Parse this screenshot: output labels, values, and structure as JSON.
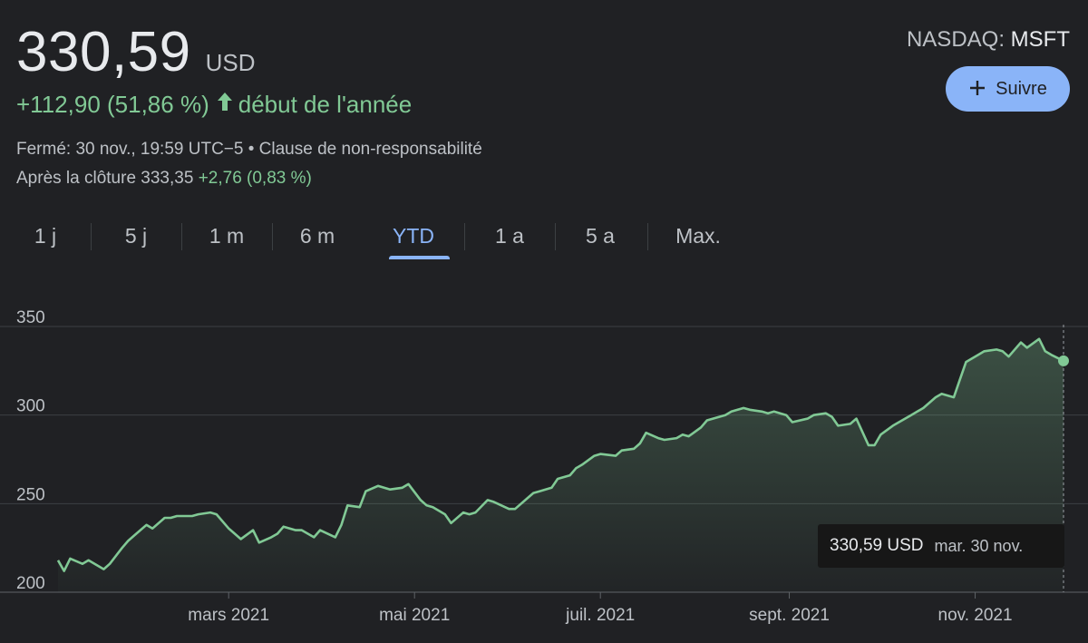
{
  "quote": {
    "price": "330,59",
    "currency": "USD",
    "change": "+112,90 (51,86 %)",
    "change_arrow": "arrow-up-icon",
    "change_period": "début de l'année",
    "closed_text": "Fermé: 30 nov., 19:59 UTC−5 • Clause de non-responsabilité",
    "after_hours_label": "Après la clôture 333,35",
    "after_hours_change": "+2,76 (0,83 %)",
    "exchange": "NASDAQ: ",
    "symbol": "MSFT"
  },
  "follow_button": {
    "label": "Suivre",
    "icon": "plus-icon"
  },
  "tabs": [
    {
      "label": "1 j",
      "active": false
    },
    {
      "label": "5 j",
      "active": false
    },
    {
      "label": "1 m",
      "active": false
    },
    {
      "label": "6 m",
      "active": false
    },
    {
      "label": "YTD",
      "active": true
    },
    {
      "label": "1 a",
      "active": false
    },
    {
      "label": "5 a",
      "active": false
    },
    {
      "label": "Max.",
      "active": false
    }
  ],
  "tooltip": {
    "price": "330,59 USD",
    "date": "mar. 30 nov."
  },
  "colors": {
    "background": "#202124",
    "positive": "#81c995",
    "accent": "#8ab4f8",
    "grid": "#3c4043"
  },
  "chart_data": {
    "type": "area",
    "ylim": [
      200,
      350
    ],
    "yticks": [
      200,
      250,
      300,
      350
    ],
    "ytick_labels": [
      "200",
      "250",
      "300",
      "350"
    ],
    "xlim": [
      "2021-01-04",
      "2021-11-30"
    ],
    "xticks": [
      "2021-03-01",
      "2021-05-01",
      "2021-07-01",
      "2021-09-01",
      "2021-11-01"
    ],
    "xtick_labels": [
      "mars 2021",
      "mai 2021",
      "juil. 2021",
      "sept. 2021",
      "nov. 2021"
    ],
    "grid": true,
    "series": [
      {
        "x": [
          "2021-01-04",
          "2021-01-06",
          "2021-01-08",
          "2021-01-12",
          "2021-01-14",
          "2021-01-19",
          "2021-01-21",
          "2021-01-25",
          "2021-01-27",
          "2021-01-29",
          "2021-02-02",
          "2021-02-04",
          "2021-02-08",
          "2021-02-10",
          "2021-02-12",
          "2021-02-17",
          "2021-02-19",
          "2021-02-23",
          "2021-02-25",
          "2021-03-01",
          "2021-03-03",
          "2021-03-05",
          "2021-03-09",
          "2021-03-11",
          "2021-03-15",
          "2021-03-17",
          "2021-03-19",
          "2021-03-23",
          "2021-03-25",
          "2021-03-29",
          "2021-03-31",
          "2021-04-05",
          "2021-04-07",
          "2021-04-09",
          "2021-04-13",
          "2021-04-15",
          "2021-04-19",
          "2021-04-21",
          "2021-04-23",
          "2021-04-27",
          "2021-04-29",
          "2021-05-03",
          "2021-05-05",
          "2021-05-07",
          "2021-05-11",
          "2021-05-13",
          "2021-05-17",
          "2021-05-19",
          "2021-05-21",
          "2021-05-25",
          "2021-05-27",
          "2021-06-01",
          "2021-06-03",
          "2021-06-07",
          "2021-06-09",
          "2021-06-11",
          "2021-06-15",
          "2021-06-17",
          "2021-06-21",
          "2021-06-23",
          "2021-06-25",
          "2021-06-29",
          "2021-07-01",
          "2021-07-06",
          "2021-07-08",
          "2021-07-12",
          "2021-07-14",
          "2021-07-16",
          "2021-07-20",
          "2021-07-22",
          "2021-07-26",
          "2021-07-28",
          "2021-07-30",
          "2021-08-03",
          "2021-08-05",
          "2021-08-09",
          "2021-08-11",
          "2021-08-13",
          "2021-08-17",
          "2021-08-19",
          "2021-08-23",
          "2021-08-25",
          "2021-08-27",
          "2021-08-31",
          "2021-09-02",
          "2021-09-07",
          "2021-09-09",
          "2021-09-13",
          "2021-09-15",
          "2021-09-17",
          "2021-09-21",
          "2021-09-23",
          "2021-09-27",
          "2021-09-29",
          "2021-10-01",
          "2021-10-05",
          "2021-10-07",
          "2021-10-11",
          "2021-10-13",
          "2021-10-15",
          "2021-10-19",
          "2021-10-21",
          "2021-10-25",
          "2021-10-27",
          "2021-10-29",
          "2021-11-02",
          "2021-11-04",
          "2021-11-08",
          "2021-11-10",
          "2021-11-12",
          "2021-11-16",
          "2021-11-18",
          "2021-11-22",
          "2021-11-24",
          "2021-11-26",
          "2021-11-30"
        ],
        "values": [
          218,
          212,
          219,
          216,
          218,
          213,
          216,
          225,
          229,
          232,
          238,
          236,
          242,
          242,
          243,
          243,
          244,
          245,
          244,
          236,
          233,
          230,
          235,
          228,
          231,
          233,
          237,
          235,
          235,
          231,
          235,
          231,
          238,
          249,
          248,
          257,
          260,
          259,
          258,
          259,
          261,
          252,
          249,
          248,
          244,
          239,
          245,
          244,
          245,
          252,
          251,
          247,
          247,
          253,
          256,
          257,
          259,
          264,
          266,
          270,
          272,
          277,
          278,
          277,
          280,
          281,
          284,
          290,
          287,
          286,
          287,
          289,
          288,
          293,
          297,
          299,
          300,
          302,
          304,
          303,
          302,
          301,
          302,
          300,
          296,
          298,
          300,
          301,
          299,
          294,
          295,
          298,
          283,
          283,
          289,
          294,
          296,
          300,
          302,
          304,
          310,
          312,
          310,
          320,
          330,
          334,
          336,
          337,
          336,
          333,
          341,
          338,
          343,
          336,
          334,
          330.59
        ]
      }
    ]
  }
}
